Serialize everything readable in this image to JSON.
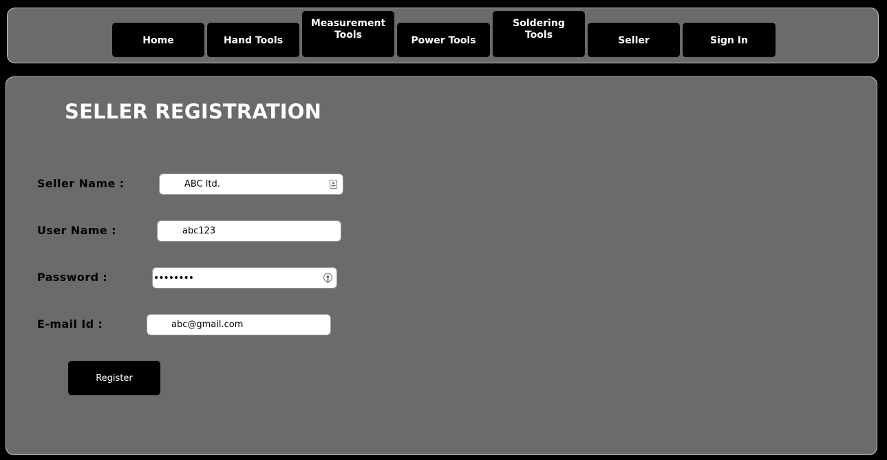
{
  "nav": {
    "items": [
      {
        "label": "Home"
      },
      {
        "label": "Hand Tools"
      },
      {
        "label": "Measurement\nTools"
      },
      {
        "label": "Power Tools"
      },
      {
        "label": "Soldering\nTools"
      },
      {
        "label": "Seller"
      },
      {
        "label": "Sign In"
      }
    ]
  },
  "form": {
    "title": "SELLER REGISTRATION",
    "seller_name": {
      "label": "Seller Name :",
      "value": "ABC ltd."
    },
    "user_name": {
      "label": "User Name :",
      "value": "abc123"
    },
    "password": {
      "label": "Password :",
      "value": "abcdefgh"
    },
    "email": {
      "label": "E-mail Id :",
      "value": "abc@gmail.com"
    },
    "register_label": "Register"
  },
  "colors": {
    "page_background": "#000000",
    "panel_background": "#6b6b6b",
    "button_background": "#000000",
    "title_text": "#ffffff"
  },
  "icons": {
    "seller_name_field": "contact-card-icon",
    "password_field": "password-key-icon"
  }
}
